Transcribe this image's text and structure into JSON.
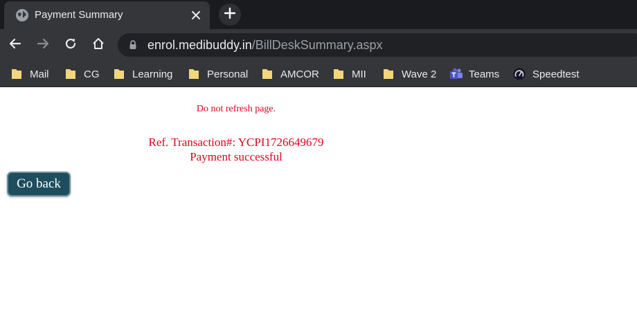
{
  "browser": {
    "tab": {
      "title": "Payment Summary"
    },
    "address": {
      "host": "enrol.medibuddy.in",
      "path": "/BillDeskSummary.aspx"
    },
    "bookmarks": [
      {
        "label": "Mail",
        "icon": "folder-icon"
      },
      {
        "label": "CG",
        "icon": "folder-icon"
      },
      {
        "label": "Learning",
        "icon": "folder-icon"
      },
      {
        "label": "Personal",
        "icon": "folder-icon"
      },
      {
        "label": "AMCOR",
        "icon": "folder-icon"
      },
      {
        "label": "MII",
        "icon": "folder-icon"
      },
      {
        "label": "Wave 2",
        "icon": "folder-icon"
      },
      {
        "label": "Teams",
        "icon": "teams-icon"
      },
      {
        "label": "Speedtest",
        "icon": "speedtest-icon"
      }
    ],
    "colors": {
      "tabstrip": "#1a1b1e",
      "toolbar": "#35363a",
      "folder": "#f3d67c",
      "teams": "#5b5fc7"
    }
  },
  "page": {
    "notice": "Do not refresh page.",
    "ref_transaction": "Ref. Transaction#: YCPI1726649679",
    "status": "Payment successful",
    "go_back_label": "Go back",
    "colors": {
      "message": "#e0001b",
      "button": "#1e4e5e"
    }
  }
}
